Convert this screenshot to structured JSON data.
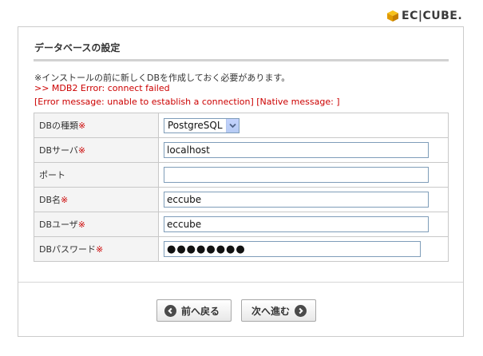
{
  "logo": {
    "text": "EC|CUBE.",
    "icon": "cube-logo-icon"
  },
  "section": {
    "title": "データベースの設定"
  },
  "messages": {
    "note": "※インストールの前に新しくDBを作成しておく必要があります。",
    "error_line1": ">> MDB2 Error: connect failed",
    "error_line2": "[Error message: unable to establish a connection] [Native message: ]"
  },
  "required_mark": "※",
  "fields": [
    {
      "label": "DBの種類",
      "required": true,
      "type": "select",
      "value": "PostgreSQL"
    },
    {
      "label": "DBサーバ",
      "required": true,
      "type": "text",
      "value": "localhost"
    },
    {
      "label": "ポート",
      "required": false,
      "type": "text",
      "value": ""
    },
    {
      "label": "DB名",
      "required": true,
      "type": "text",
      "value": "eccube"
    },
    {
      "label": "DBユーザ",
      "required": true,
      "type": "text",
      "value": "eccube"
    },
    {
      "label": "DBパスワード",
      "required": true,
      "type": "password",
      "value": "●●●●●●●●"
    }
  ],
  "buttons": {
    "back_label": "前へ戻る",
    "next_label": "次へ進む"
  },
  "colors": {
    "required": "#cc0000",
    "error": "#cc0000",
    "accent": "#f0a800"
  }
}
